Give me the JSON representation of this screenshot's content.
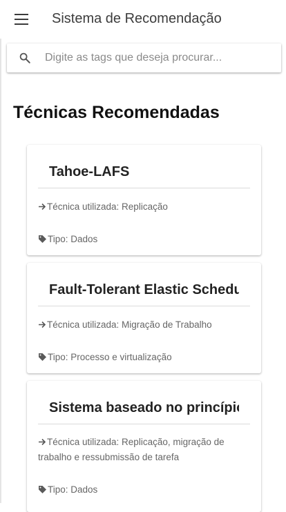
{
  "app": {
    "title": "Sistema de Recomendação"
  },
  "search": {
    "placeholder": "Digite as tags que deseja procurar...",
    "value": ""
  },
  "section": {
    "title": "Técnicas Recomendadas"
  },
  "cards": [
    {
      "title": "Tahoe-LAFS",
      "technique": "Técnica utilizada: Replicação",
      "type": "Tipo: Dados"
    },
    {
      "title": "Fault-Tolerant Elastic Scheduling",
      "technique": "Técnica utilizada: Migração de Trabalho",
      "type": "Tipo: Processo e virtualização"
    },
    {
      "title": "Sistema baseado no princípio",
      "technique": "Técnica utilizada: Replicação, migração de trabalho e ressubmissão de tarefa",
      "type": "Tipo: Dados"
    }
  ],
  "icons": {
    "menu": "menu-icon",
    "search": "search-icon",
    "technique": "arrow-right-icon",
    "type": "tag-icon"
  },
  "colors": {
    "text_primary": "#222222",
    "text_secondary": "#666666",
    "background": "#ffffff"
  }
}
